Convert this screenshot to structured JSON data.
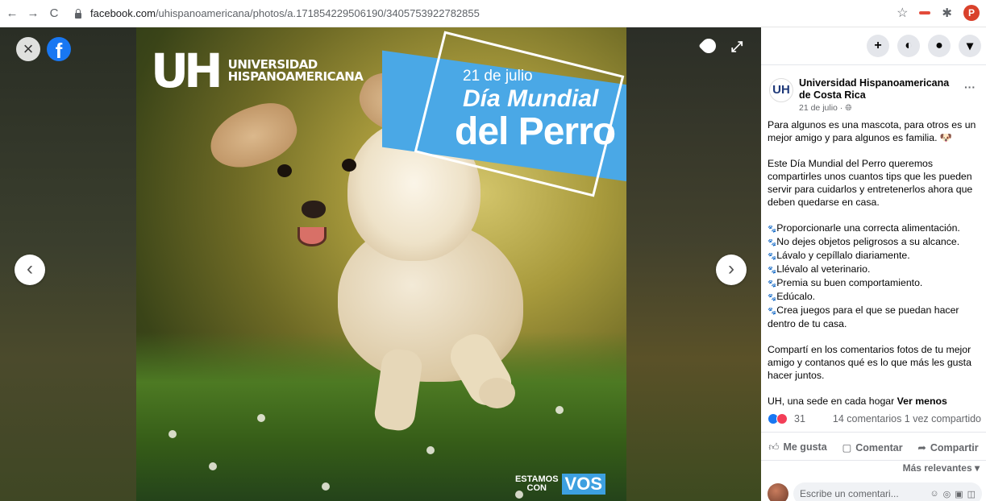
{
  "browser": {
    "back": "←",
    "forward": "→",
    "reload": "C",
    "url_host": "facebook.com",
    "url_path": "/uhispanoamericana/photos/a.171854229506190/3405753922782855",
    "profile_initial": "P"
  },
  "viewer": {
    "close": "×",
    "fb_logo": "f",
    "prev": "‹",
    "next": "›",
    "expand": "⤢",
    "image": {
      "logo_mark": "UH",
      "logo_line1": "UNIVERSIDAD",
      "logo_line2": "HISPANOAMERICANA",
      "banner_date": "21 de julio",
      "banner_line2": "Día Mundial",
      "banner_line3": "del Perro",
      "footer_small1": "ESTAMOS",
      "footer_small2": "CON",
      "footer_big": "VOS"
    }
  },
  "panel": {
    "top_icons": [
      "+",
      "messenger-icon",
      "bell-icon",
      "caret-down-icon"
    ],
    "top_icon_glyphs": [
      "+",
      "◐",
      "●",
      "▾"
    ],
    "page_avatar": "UH",
    "page_name": "Universidad Hispanoamericana de Costa Rica",
    "more": "···",
    "date": "21 de julio · ",
    "globe": "🌐︎",
    "paragraph1": "Para algunos es una mascota, para otros es un mejor amigo y para algunos es familia. 🐶",
    "paragraph2": "Este Día Mundial del Perro queremos compartirles unos cuantos tips que les pueden servir para cuidarlos y entretenerlos ahora que deben quedarse en casa.",
    "paw": "🐾",
    "tips": [
      "Proporcionarle una correcta alimentación.",
      "No dejes objetos peligrosos a su alcance.",
      "Lávalo y cepíllalo diariamente.",
      "Llévalo al veterinario.",
      "Premia su buen comportamiento.",
      "Edúcalo.",
      "Crea juegos para el que se puedan hacer dentro de tu casa."
    ],
    "paragraph3": "Compartí en los comentarios fotos de tu mejor amigo y contanos qué es lo que más les gusta hacer juntos.",
    "paragraph4": "UH, una sede en cada hogar ",
    "see_less": "Ver menos",
    "reaction_count": "31",
    "comments_shares": "14 comentarios  1 vez compartido",
    "like_label": "Me gusta",
    "comment_label": "Comentar",
    "share_label": "Compartir",
    "sort_label": "Más relevantes ▾",
    "comment_placeholder": "Escribe un comentari..."
  }
}
